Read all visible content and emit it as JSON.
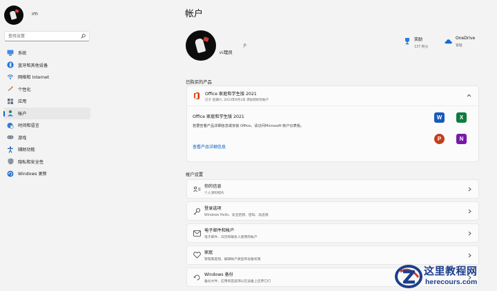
{
  "sidebar": {
    "user_name": "ım",
    "search_placeholder": "查找设置",
    "items": [
      {
        "label": "系统",
        "icon": "monitor-icon",
        "active": false
      },
      {
        "label": "蓝牙和其他设备",
        "icon": "bluetooth-icon",
        "active": false
      },
      {
        "label": "网络和 Internet",
        "icon": "wifi-icon",
        "active": false
      },
      {
        "label": "个性化",
        "icon": "brush-icon",
        "active": false
      },
      {
        "label": "应用",
        "icon": "apps-icon",
        "active": false
      },
      {
        "label": "帐户",
        "icon": "person-icon",
        "active": true
      },
      {
        "label": "时间和语言",
        "icon": "globe-clock-icon",
        "active": false
      },
      {
        "label": "游戏",
        "icon": "gamepad-icon",
        "active": false
      },
      {
        "label": "辅助功能",
        "icon": "accessibility-icon",
        "active": false
      },
      {
        "label": "隐私和安全性",
        "icon": "shield-icon",
        "active": false
      },
      {
        "label": "Windows 更新",
        "icon": "update-icon",
        "active": false
      }
    ]
  },
  "main": {
    "title": "帐户",
    "profile": {
      "name": "ι⁄₂理员",
      "mark": "ɲ"
    },
    "rewards": {
      "title": "奖励",
      "subtitle": "137 积分"
    },
    "onedrive": {
      "title": "OneDrive",
      "subtitle": "管理"
    },
    "purchased_label": "已购买的产品",
    "office": {
      "title": "Office 家庭和学生版 2021",
      "subtitle": "已于 星期六, 2023年6月3日 添加到你的帐户",
      "body_title": "Office 家庭和学生版 2021",
      "description": "若要查看产品详细信息或安装 Office，请访问Microsoft 帐户仪表板。",
      "link": "查看产品详细信息",
      "apps": [
        {
          "name": "word-icon",
          "letter": "W",
          "color": "#185abd"
        },
        {
          "name": "excel-icon",
          "letter": "X",
          "color": "#107c41"
        },
        {
          "name": "powerpoint-icon",
          "letter": "P",
          "color": "#c43e1c"
        },
        {
          "name": "onenote-icon",
          "letter": "N",
          "color": "#7719aa"
        }
      ]
    },
    "account_settings_label": "帐户设置",
    "settings": [
      {
        "title": "你的信息",
        "subtitle": "个人资料照片",
        "icon": "user-card-icon",
        "name": "your-info"
      },
      {
        "title": "登录选项",
        "subtitle": "Windows Hello、安全密钥、密码、动态锁",
        "icon": "key-icon",
        "name": "sign-in-options"
      },
      {
        "title": "电子邮件和帐户",
        "subtitle": "电子邮件、日历和联系人使用的帐户",
        "icon": "mail-icon",
        "name": "email-accounts"
      },
      {
        "title": "家庭",
        "subtitle": "管理家庭组、编辑帐户类型和设备权限",
        "icon": "heart-icon",
        "name": "family"
      },
      {
        "title": "Windows 备份",
        "subtitle": "备份文件、应用和首选项以在设备上还原它们",
        "icon": "backup-icon",
        "name": "windows-backup"
      }
    ]
  },
  "watermark": {
    "title": "这里教程网",
    "url": "herecours.com"
  }
}
